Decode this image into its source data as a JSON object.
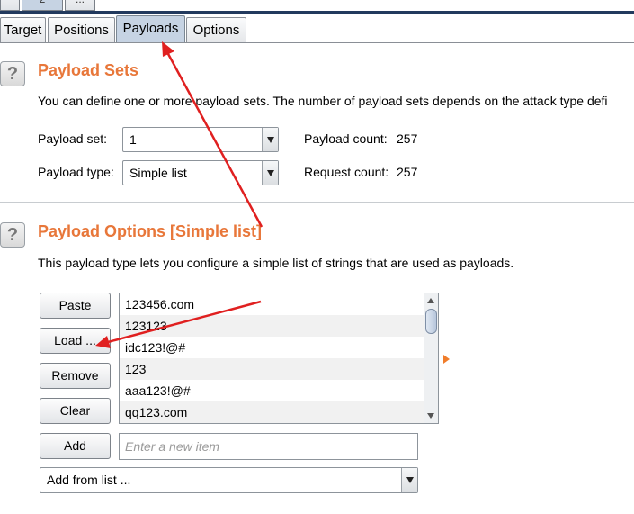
{
  "top_tabs": [
    "",
    "2",
    "..."
  ],
  "tabs": [
    {
      "label": "Target"
    },
    {
      "label": "Positions"
    },
    {
      "label": "Payloads"
    },
    {
      "label": "Options"
    }
  ],
  "payload_sets": {
    "title": "Payload Sets",
    "description": "You can define one or more payload sets. The number of payload sets depends on the attack type defi",
    "payload_set_label": "Payload set:",
    "payload_set_value": "1",
    "payload_type_label": "Payload type:",
    "payload_type_value": "Simple list",
    "payload_count_label": "Payload count:",
    "payload_count": "257",
    "request_count_label": "Request count:",
    "request_count": "257"
  },
  "payload_options": {
    "title": "Payload Options [Simple list]",
    "description": "This payload type lets you configure a simple list of strings that are used as payloads.",
    "buttons": {
      "paste": "Paste",
      "load": "Load ...",
      "remove": "Remove",
      "clear": "Clear",
      "add": "Add"
    },
    "items": [
      "123456.com",
      "123123",
      "idc123!@#",
      "123",
      "aaa123!@#",
      "qq123.com"
    ],
    "new_item_placeholder": "Enter a new item",
    "add_from_list": "Add from list ..."
  },
  "help_icon_glyph": "?",
  "colors": {
    "accent_title": "#e8773a",
    "annotation_arrow": "#e02020",
    "active_tab": "#c6d3e3"
  }
}
